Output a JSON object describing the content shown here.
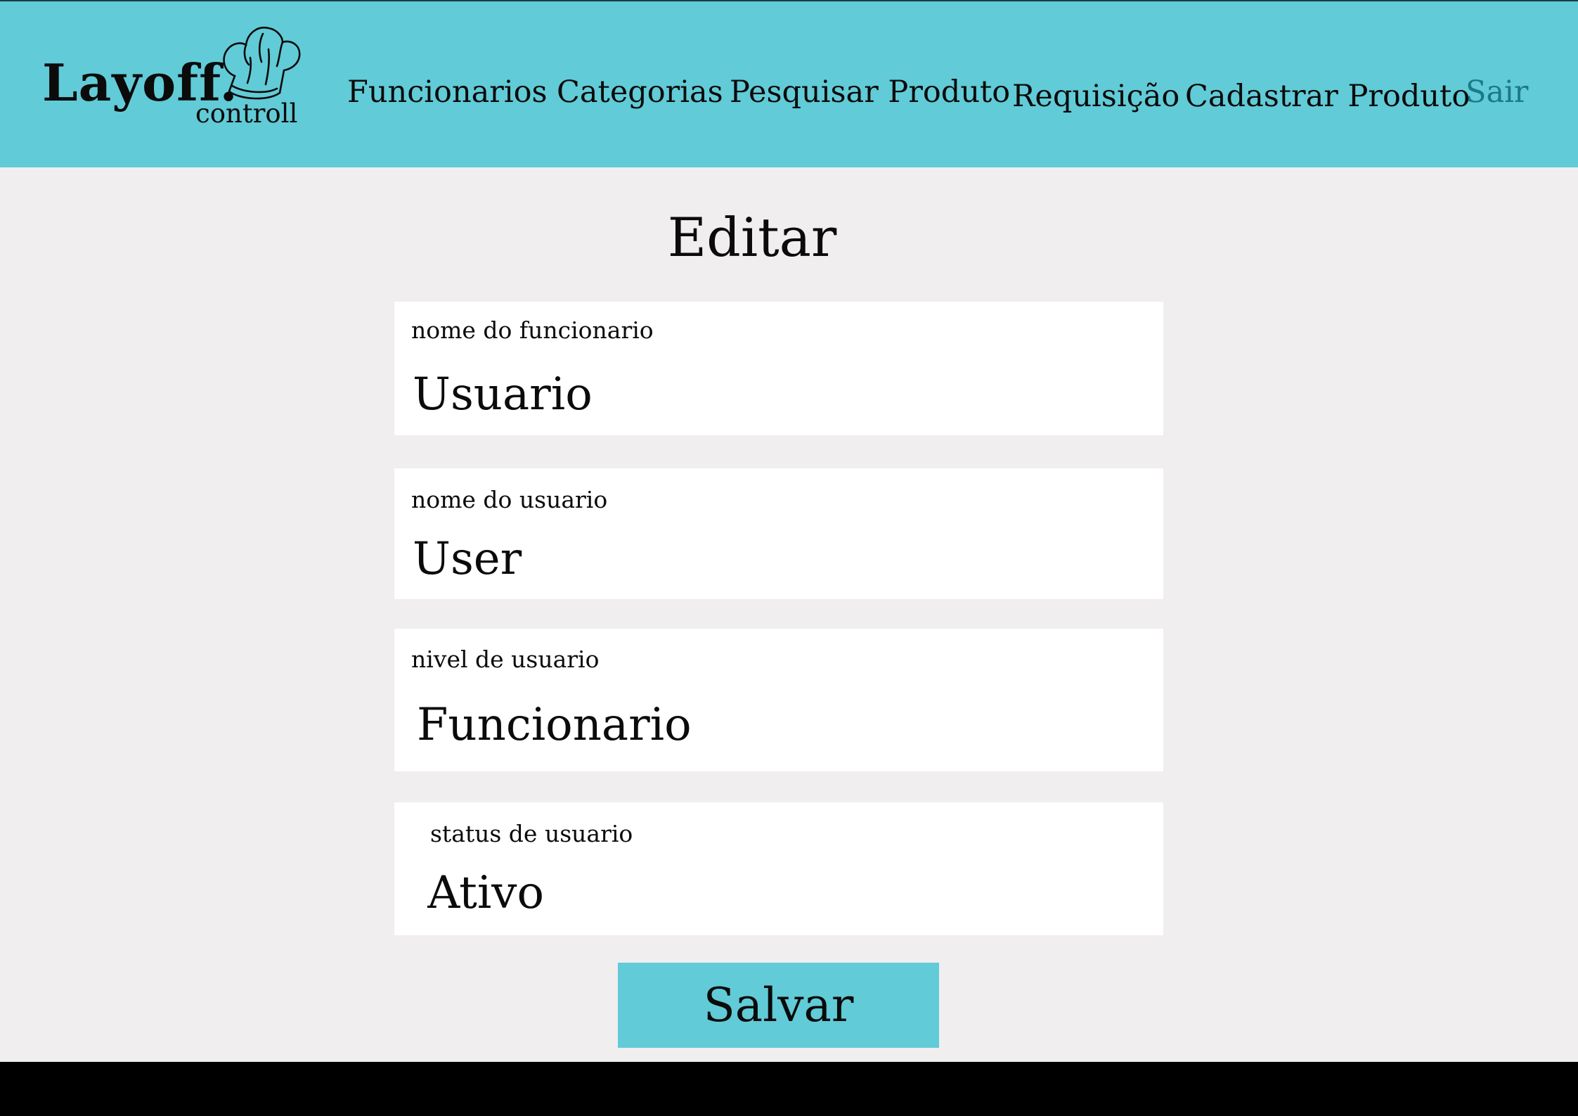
{
  "brand": {
    "name": "Layoff.",
    "sub": "controll",
    "icon": "chef-hat-icon"
  },
  "nav": {
    "funcionarios": "Funcionarios",
    "categorias": "Categorias",
    "pesquisar": "Pesquisar Produto",
    "requisicao": "Requisição",
    "cadastrar": "Cadastrar Produto",
    "sair": "Sair"
  },
  "page": {
    "title": "Editar"
  },
  "form": {
    "fields": [
      {
        "label": "nome do funcionario",
        "value": "Usuario"
      },
      {
        "label": "nome do usuario",
        "value": "User"
      },
      {
        "label": "nivel de usuario",
        "value": "Funcionario"
      },
      {
        "label": "status de usuario",
        "value": "Ativo"
      }
    ],
    "save_label": "Salvar"
  },
  "colors": {
    "header": "#61cbd7",
    "background": "#f0eeef",
    "footer": "#000000",
    "accent_link": "#1a7a86",
    "button": "#61cbd7"
  }
}
